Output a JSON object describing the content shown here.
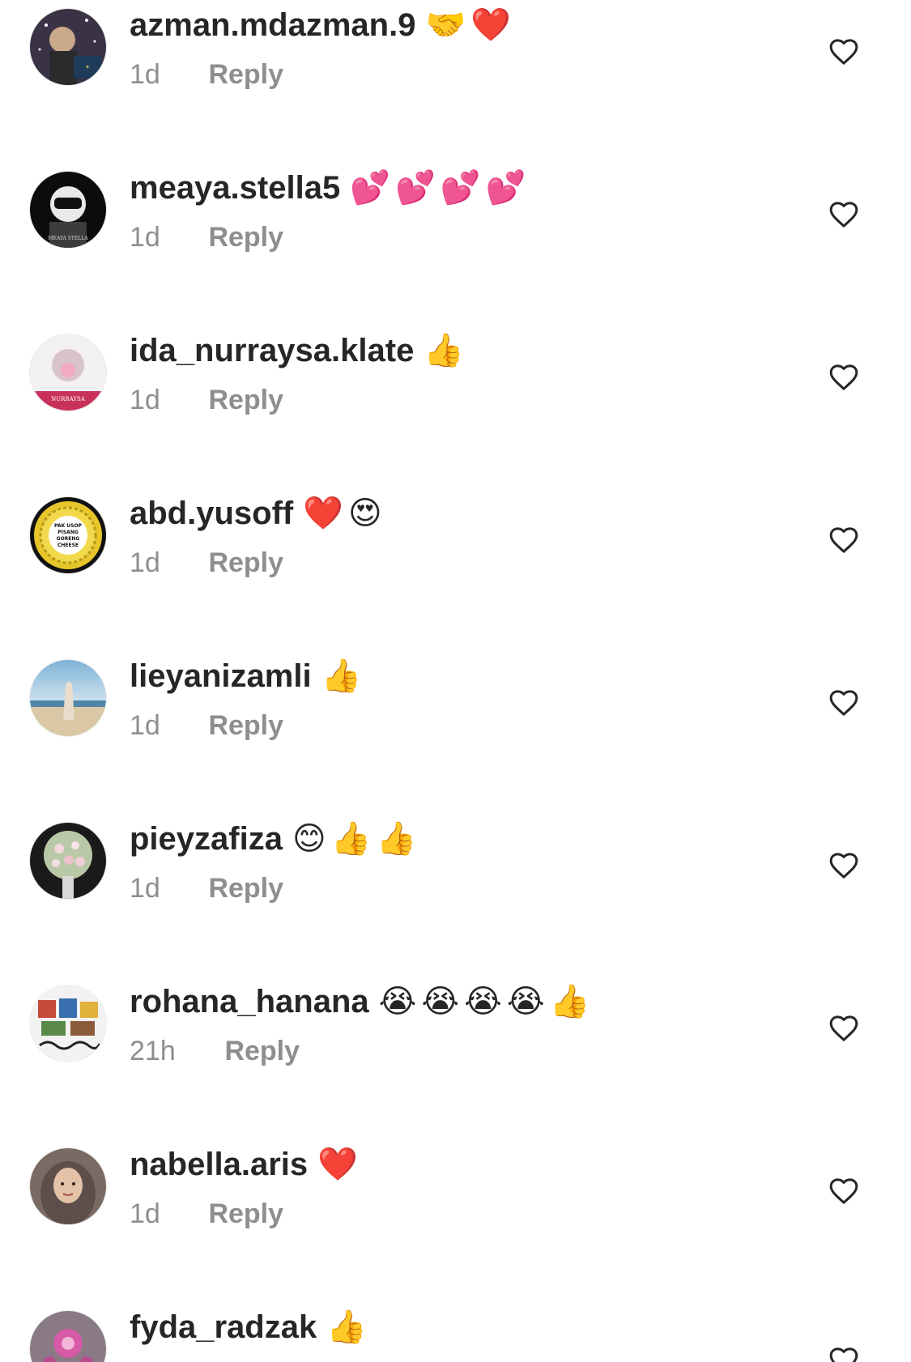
{
  "comments": [
    {
      "username": "azman.mdazman.9",
      "text": "🤝❤️",
      "time": "1d",
      "reply_label": "Reply"
    },
    {
      "username": "meaya.stella5",
      "text": "💕💕💕💕",
      "time": "1d",
      "reply_label": "Reply"
    },
    {
      "username": "ida_nurraysa.klate",
      "text": "👍",
      "time": "1d",
      "reply_label": "Reply"
    },
    {
      "username": "abd.yusoff",
      "text": "❤️😍",
      "time": "1d",
      "reply_label": "Reply"
    },
    {
      "username": "lieyanizamli",
      "text": "👍",
      "time": "1d",
      "reply_label": "Reply"
    },
    {
      "username": "pieyzafiza",
      "text": "😊👍👍",
      "time": "1d",
      "reply_label": "Reply"
    },
    {
      "username": "rohana_hanana",
      "text": "😭😭😭😭👍",
      "time": "21h",
      "reply_label": "Reply"
    },
    {
      "username": "nabella.aris",
      "text": "❤️",
      "time": "1d",
      "reply_label": "Reply"
    },
    {
      "username": "fyda_radzak",
      "text": "👍",
      "time": "",
      "reply_label": ""
    }
  ],
  "avatar_texts": {
    "meaya": "MEAYA STELLA",
    "ida": "NURRAYSA",
    "abd": [
      "PAK USOP",
      "PISANG",
      "GORENG",
      "CHEESE"
    ]
  },
  "icons": {
    "like": "heart-outline-icon"
  },
  "colors": {
    "text": "#262626",
    "secondary": "#8e8e8e",
    "background": "#ffffff"
  }
}
